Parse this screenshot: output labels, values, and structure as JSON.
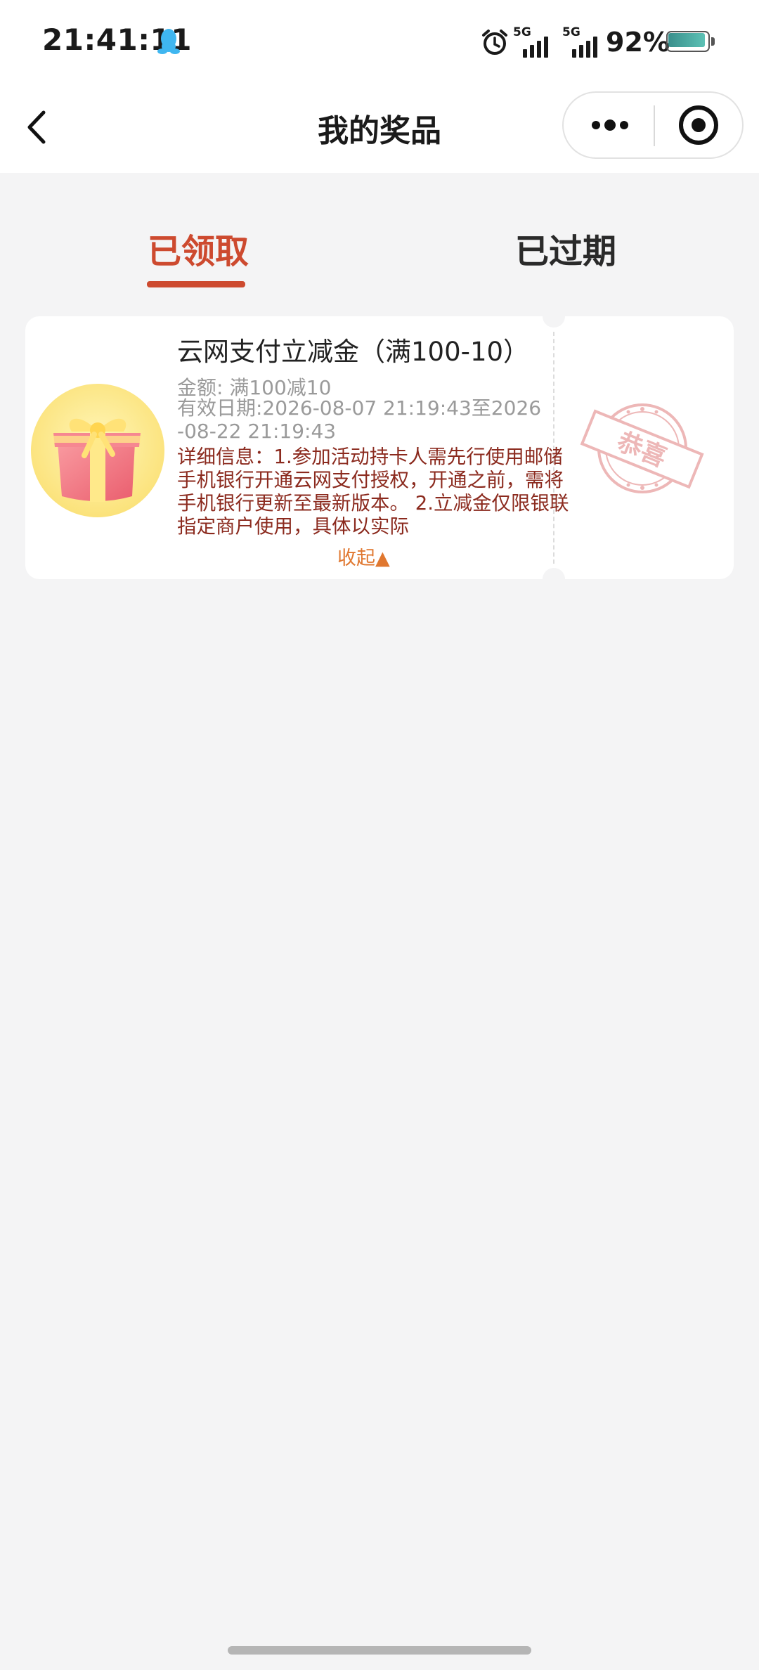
{
  "status_bar": {
    "time": "21:41:11",
    "network_1": "5G",
    "network_2": "5G",
    "battery_percent": "92%",
    "battery_level": 0.92,
    "icons": [
      "qq-penguin-icon",
      "alarm-clock-icon",
      "signal-icon",
      "signal-icon",
      "battery-icon"
    ]
  },
  "nav": {
    "title": "我的奖品",
    "back_icon": "chevron-left-icon",
    "more_icon": "more-dots-icon",
    "close_icon": "target-circle-icon"
  },
  "tabs": [
    {
      "label": "已领取",
      "active": true
    },
    {
      "label": "已过期",
      "active": false
    }
  ],
  "accent_color": "#cd4a2f",
  "prize": {
    "title": "云网支付立减金（满100-10）",
    "amount": "金额: 满100减10",
    "validity": "有效日期:2026-08-07 21:19:43至2026-08-22 21:19:43",
    "detail": "详细信息：1.参加活动持卡人需先行使用邮储手机银行开通云网支付授权，开通之前，需将手机银行更新至最新版本。 2.立减金仅限银联指定商户使用，具体以实际",
    "collapse_label": "收起▲",
    "image_icon": "gift-box-icon",
    "stamp_text": "恭喜",
    "detail_color": "#8b2a1e",
    "collapse_color": "#e0772f"
  }
}
